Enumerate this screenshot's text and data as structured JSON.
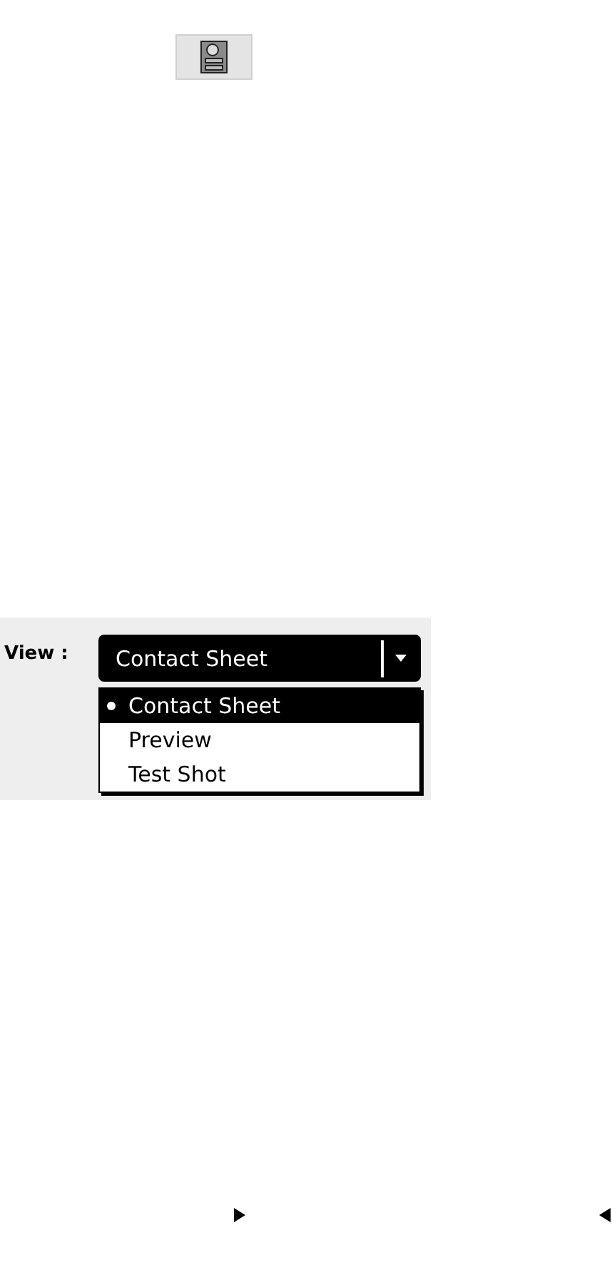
{
  "view_control": {
    "label": "View :",
    "value": "Contact Sheet",
    "options": [
      {
        "label": "Contact Sheet",
        "selected": true
      },
      {
        "label": "Preview",
        "selected": false
      },
      {
        "label": "Test Shot",
        "selected": false
      }
    ]
  }
}
